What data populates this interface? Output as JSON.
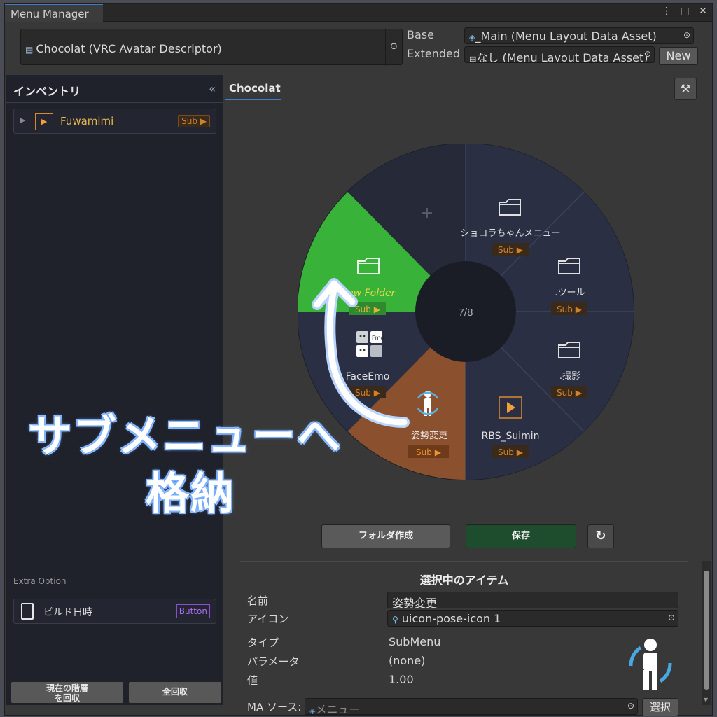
{
  "window": {
    "title": "Menu Manager"
  },
  "descriptor": {
    "value": "Chocolat (VRC Avatar Descriptor)"
  },
  "base": {
    "label": "Base",
    "value": "_Main (Menu Layout Data Asset)"
  },
  "extended": {
    "label": "Extended",
    "value": "なし (Menu Layout Data Asset)",
    "new_label": "New"
  },
  "inventory": {
    "title": "インベントリ",
    "collapse": "«",
    "items": [
      {
        "name": "Fuwamimi",
        "tag": "Sub ▶"
      }
    ],
    "extra_label": "Extra Option",
    "extra_items": [
      {
        "name": "ビルド日時",
        "tag": "Button"
      }
    ],
    "button_restore_line1": "現在の階層",
    "button_restore_line2": "を回収",
    "button_restore_all": "全回収"
  },
  "main": {
    "tab": "Chocolat",
    "page_indicator": "7/8",
    "add_symbol": "+",
    "slots": [
      {
        "label": "ショコラちゃんメニュー",
        "tag": "Sub ▶",
        "icon": "folder-icon"
      },
      {
        "label": ".ツール",
        "tag": "Sub ▶",
        "icon": "folder-icon"
      },
      {
        "label": ".撮影",
        "tag": "Sub ▶",
        "icon": "folder-icon"
      },
      {
        "label": "RBS_Suimin",
        "tag": "Sub ▶",
        "icon": "play-icon"
      },
      {
        "label": "姿勢変更",
        "tag": "Sub ▶",
        "icon": "pose-icon"
      },
      {
        "label": "FaceEmo",
        "tag": "Sub ▶",
        "icon": "faceemo-icon"
      },
      {
        "label": "New Folder",
        "tag": "Sub ▶",
        "icon": "folder-icon"
      }
    ],
    "colors": {
      "wheel_bg": "#2a2f44",
      "selected_green": "#3ab03a",
      "selected_orange": "#8a4f2c",
      "accent": "#d0822a"
    },
    "btn_create_folder": "フォルダ作成",
    "btn_save": "保存",
    "refresh_icon": "↻"
  },
  "selected": {
    "title": "選択中のアイテム",
    "name_label": "名前",
    "name_value": "姿勢変更",
    "icon_label": "アイコン",
    "icon_value": "uicon-pose-icon 1",
    "type_label": "タイプ",
    "type_value": "SubMenu",
    "param_label": "パラメータ",
    "param_value": "(none)",
    "value_label": "値",
    "value_value": "1.00",
    "source_label": "MA ソース:",
    "source_value": "メニュー",
    "select_button": "選択"
  },
  "overlay": {
    "line1": "サブメニューへ",
    "line2": "格納"
  }
}
